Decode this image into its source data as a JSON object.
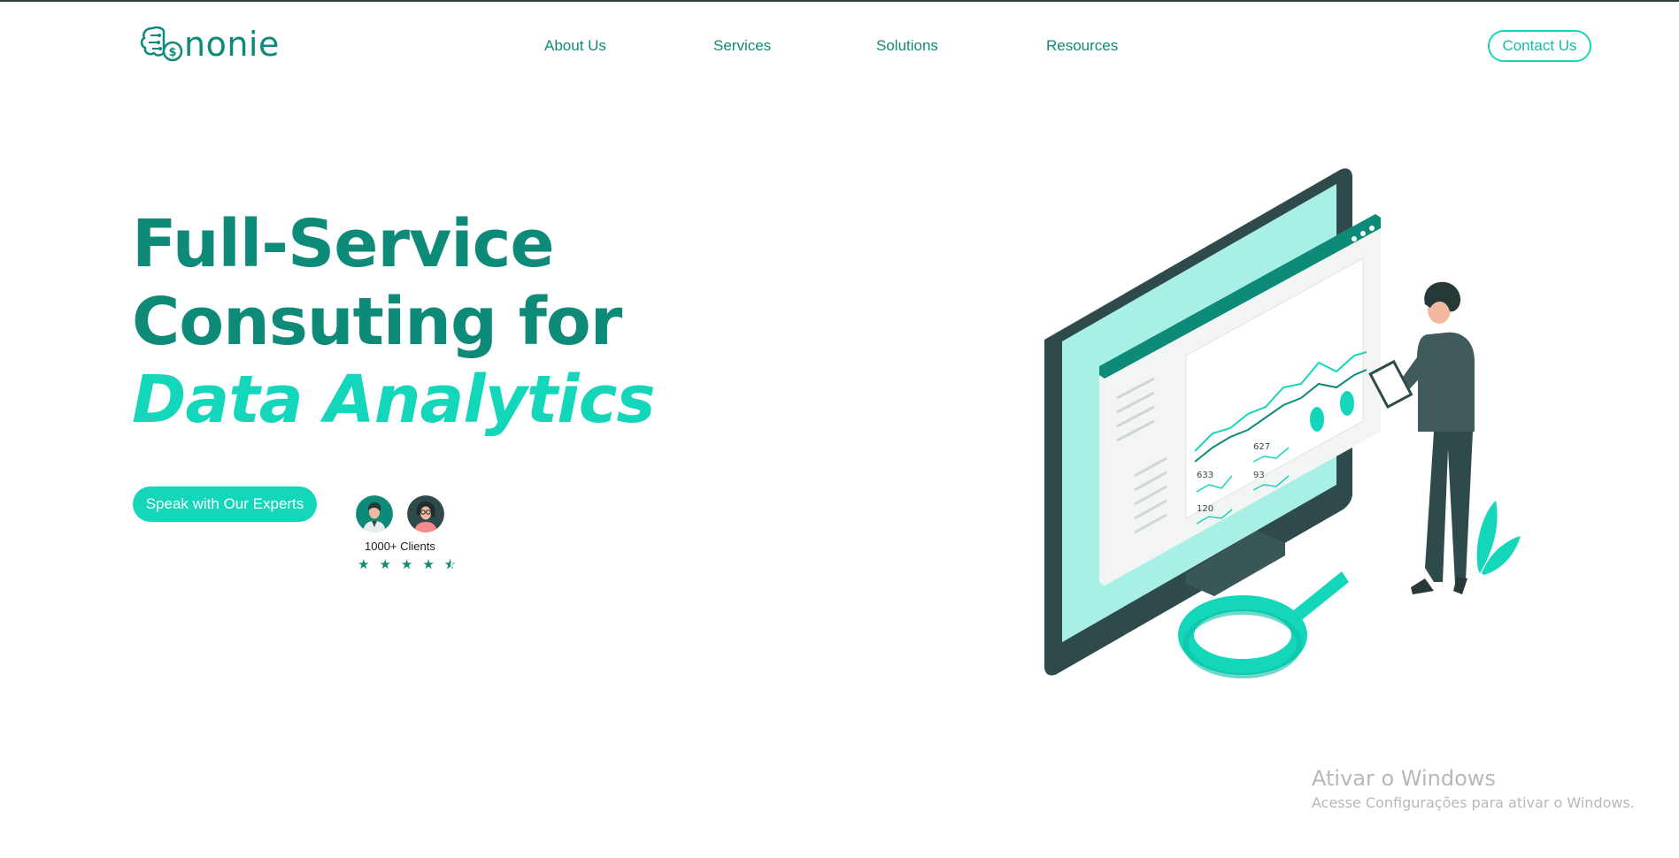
{
  "brand": {
    "name": "nonie",
    "logo_icon": "brain-coin-icon"
  },
  "nav": {
    "about": "About Us",
    "services": "Services",
    "solutions": "Solutions",
    "resources": "Resources"
  },
  "header": {
    "contact_label": "Contact Us"
  },
  "hero": {
    "line1": "Full-Service",
    "line2": "Consuting for",
    "line3": "Data Analytics",
    "cta_label": "Speak with Our Experts"
  },
  "clients": {
    "label": "1000+ Clients",
    "rating": 4.5,
    "rating_max": 5,
    "star_icon": "star-icon"
  },
  "illustration": {
    "chart_labels": [
      "627",
      "633",
      "93",
      "120"
    ]
  },
  "watermark": {
    "title": "Ativar o Windows",
    "subtitle": "Acesse Configurações para ativar o Windows."
  },
  "colors": {
    "primary": "#0e8a78",
    "accent": "#13d6bb",
    "dark": "#2f4a4a"
  }
}
